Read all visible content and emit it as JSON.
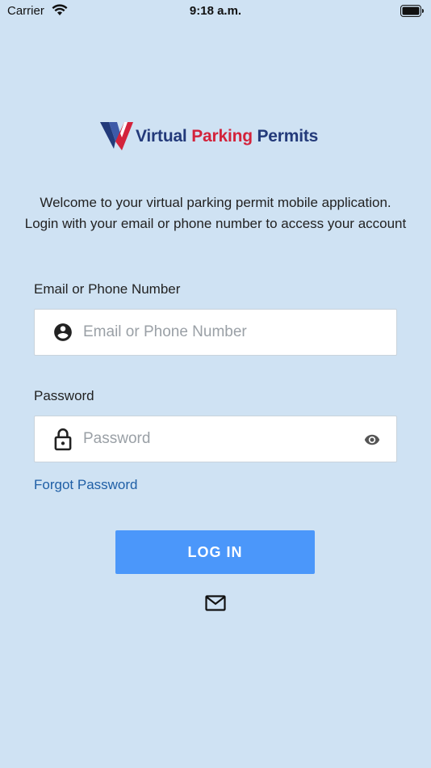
{
  "status_bar": {
    "carrier": "Carrier",
    "time": "9:18 a.m."
  },
  "logo": {
    "word1": "Virtual",
    "word2": "Parking",
    "word3": "Permits",
    "colors": {
      "navy": "#233a7a",
      "red": "#d3233b"
    }
  },
  "welcome_text": "Welcome to your virtual parking permit mobile application. Login with your email or phone number to access your account",
  "email": {
    "label": "Email or Phone Number",
    "placeholder": "Email or Phone Number",
    "value": "",
    "icon": "account-circle-icon"
  },
  "password": {
    "label": "Password",
    "placeholder": "Password",
    "value": "",
    "icon": "lock-icon",
    "toggle_icon": "eye-icon"
  },
  "forgot_password": "Forgot Password",
  "login_button": "LOG IN",
  "contact_icon": "mail-icon",
  "colors": {
    "background": "#cfe2f3",
    "accent": "#4b97fa",
    "link": "#1f5fa6"
  }
}
